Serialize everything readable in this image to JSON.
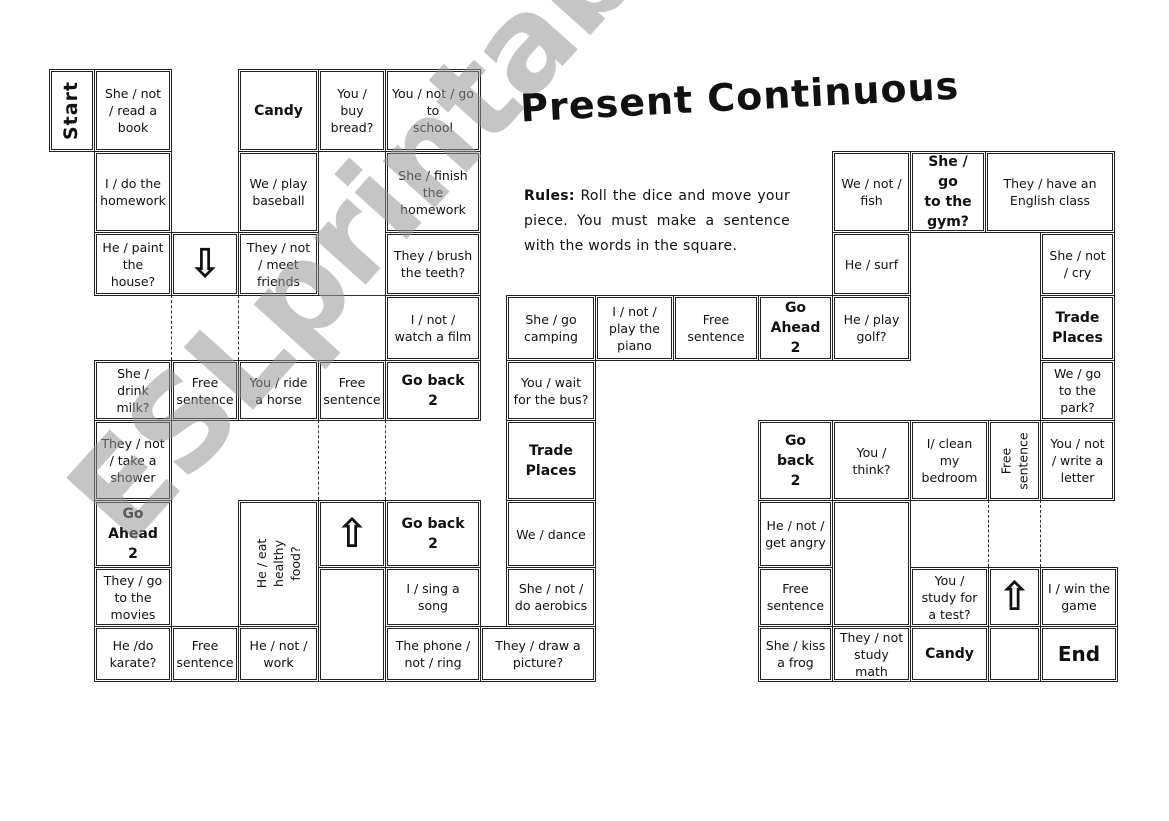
{
  "title": "Present Continuous",
  "rules": {
    "label": "Rules:",
    "text": " Roll the dice and move your piece. You must make a sentence with the words in the square."
  },
  "watermark": "ESLprintables.com",
  "squares": {
    "start": "Start",
    "s1": "She / not\n/ read a\nbook",
    "s2": "I / do the\nhomework",
    "s3": "He / paint\nthe\nhouse?",
    "s4_arrow": "arrow-down",
    "s5": "They / not\n/ meet\nfriends",
    "s6": "We / play\nbaseball",
    "s7": "Candy",
    "s8": "You /\nbuy\nbread?",
    "s9": "You / not / go\nto\nschool",
    "s10": "She / finish\nthe\nhomework",
    "s11": "They / brush\nthe teeth?",
    "s12": "I / not /\nwatch a film",
    "s13": "Go back\n2",
    "s14": "Free\nsentence",
    "s15": "You / ride\na horse",
    "s16": "Free\nsentence",
    "s17": "She /\ndrink\nmilk?",
    "s18": "They / not\n/ take a\nshower",
    "s19": "Go\nAhead\n2",
    "s20": "They / go\nto the\nmovies",
    "s21": "He /do\nkarate?",
    "s22": "Free\nsentence",
    "s23": "He / not /\nwork",
    "s24": "He / eat healthy\nfood?",
    "s25_arrow": "arrow-up",
    "s26": "Go back\n2",
    "s27": "I / sing a\nsong",
    "s28": "The phone /\nnot / ring",
    "s29": "They / draw a\npicture?",
    "s30": "She / not /\ndo aerobics",
    "s31": "We / dance",
    "s32": "Trade\nPlaces",
    "s33": "You / wait\nfor the bus?",
    "s34": "She / go\ncamping",
    "s35": "I / not /\nplay the\npiano",
    "s36": "Free\nsentence",
    "s37": "Go\nAhead\n2",
    "s38": "He / play\ngolf?",
    "s39": "He / surf",
    "s40": "We / not /\nfish",
    "s41": "She / go\nto the\ngym?",
    "s42": "They / have an\nEnglish class",
    "s43": "She / not\n/ cry",
    "s44": "Trade\nPlaces",
    "s45": "We / go\nto the\npark?",
    "s46": "You / not\n/ write  a\nletter",
    "s47": "Free\nsentence",
    "s48": "I/ clean\nmy\nbedroom",
    "s49": "You /\nthink?",
    "s50": "Go back\n2",
    "s51": "He / not /\nget angry",
    "s52": "Free\nsentence",
    "s53": "She / kiss\na frog",
    "s54": "They / not\nstudy\nmath",
    "s55": "Candy",
    "s56": "You /\nstudy for\na test?",
    "s57_arrow": "arrow-up",
    "s58": "I / win the\ngame",
    "s59": "End"
  },
  "arrow_glyphs": {
    "up": "⇧",
    "down": "⇩"
  }
}
